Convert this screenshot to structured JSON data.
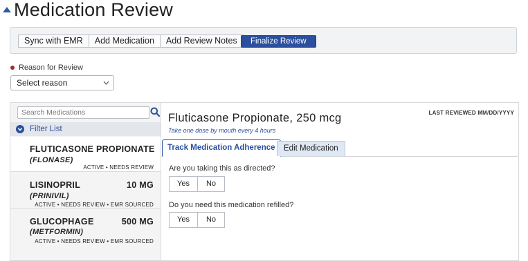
{
  "page": {
    "title": "Medication Review"
  },
  "toolbar": {
    "sync_label": "Sync with EMR",
    "add_medication_label": "Add Medication",
    "add_notes_label": "Add Review Notes",
    "finalize_label": "Finalize Review"
  },
  "reason": {
    "label": "Reason for Review",
    "selected": "Select reason"
  },
  "search": {
    "placeholder": "Search Medications"
  },
  "filter": {
    "label": "Filter List"
  },
  "medications": [
    {
      "name": "FLUTICASONE PROPIONATE",
      "dose": "",
      "brand": "(FLONASE)",
      "status": "ACTIVE • NEEDS REVIEW"
    },
    {
      "name": "LISINOPRIL",
      "dose": "10 MG",
      "brand": "(PRINIVIL)",
      "status": "ACTIVE • NEEDS REVIEW • EMR SOURCED"
    },
    {
      "name": "GLUCOPHAGE",
      "dose": "500 MG",
      "brand": "(METFORMIN)",
      "status": "ACTIVE • NEEDS REVIEW • EMR SOURCED"
    }
  ],
  "detail": {
    "title": "Fluticasone Propionate, 250 mcg",
    "sig": "Take one dose by mouth every 4 hours",
    "last_reviewed": "LAST REVIEWED MM/DD/YYYY",
    "tabs": [
      {
        "label": "Track Medication Adherence"
      },
      {
        "label": "Edit Medication"
      }
    ],
    "questions": [
      {
        "text": "Are you taking this as directed?",
        "yes": "Yes",
        "no": "No"
      },
      {
        "text": "Do you need this medication refilled?",
        "yes": "Yes",
        "no": "No"
      }
    ]
  },
  "colors": {
    "accent": "#2b4f9e",
    "required_dot": "#a52a2a",
    "toolbar_bg": "#f2f3f4",
    "list_bg": "#f4f4f4"
  },
  "icons": {
    "collapse": "caret-up-icon",
    "search": "search-icon",
    "filter": "chevron-down-circle-icon",
    "select": "chevron-down-icon"
  }
}
